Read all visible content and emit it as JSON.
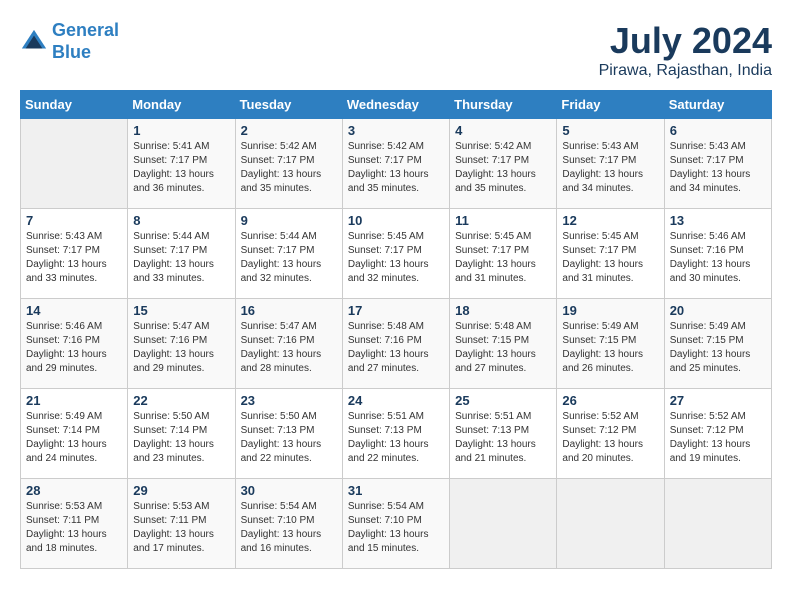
{
  "header": {
    "logo_line1": "General",
    "logo_line2": "Blue",
    "month_year": "July 2024",
    "location": "Pirawa, Rajasthan, India"
  },
  "weekdays": [
    "Sunday",
    "Monday",
    "Tuesday",
    "Wednesday",
    "Thursday",
    "Friday",
    "Saturday"
  ],
  "weeks": [
    [
      {
        "day": "",
        "sunrise": "",
        "sunset": "",
        "daylight": ""
      },
      {
        "day": "1",
        "sunrise": "Sunrise: 5:41 AM",
        "sunset": "Sunset: 7:17 PM",
        "daylight": "Daylight: 13 hours and 36 minutes."
      },
      {
        "day": "2",
        "sunrise": "Sunrise: 5:42 AM",
        "sunset": "Sunset: 7:17 PM",
        "daylight": "Daylight: 13 hours and 35 minutes."
      },
      {
        "day": "3",
        "sunrise": "Sunrise: 5:42 AM",
        "sunset": "Sunset: 7:17 PM",
        "daylight": "Daylight: 13 hours and 35 minutes."
      },
      {
        "day": "4",
        "sunrise": "Sunrise: 5:42 AM",
        "sunset": "Sunset: 7:17 PM",
        "daylight": "Daylight: 13 hours and 35 minutes."
      },
      {
        "day": "5",
        "sunrise": "Sunrise: 5:43 AM",
        "sunset": "Sunset: 7:17 PM",
        "daylight": "Daylight: 13 hours and 34 minutes."
      },
      {
        "day": "6",
        "sunrise": "Sunrise: 5:43 AM",
        "sunset": "Sunset: 7:17 PM",
        "daylight": "Daylight: 13 hours and 34 minutes."
      }
    ],
    [
      {
        "day": "7",
        "sunrise": "Sunrise: 5:43 AM",
        "sunset": "Sunset: 7:17 PM",
        "daylight": "Daylight: 13 hours and 33 minutes."
      },
      {
        "day": "8",
        "sunrise": "Sunrise: 5:44 AM",
        "sunset": "Sunset: 7:17 PM",
        "daylight": "Daylight: 13 hours and 33 minutes."
      },
      {
        "day": "9",
        "sunrise": "Sunrise: 5:44 AM",
        "sunset": "Sunset: 7:17 PM",
        "daylight": "Daylight: 13 hours and 32 minutes."
      },
      {
        "day": "10",
        "sunrise": "Sunrise: 5:45 AM",
        "sunset": "Sunset: 7:17 PM",
        "daylight": "Daylight: 13 hours and 32 minutes."
      },
      {
        "day": "11",
        "sunrise": "Sunrise: 5:45 AM",
        "sunset": "Sunset: 7:17 PM",
        "daylight": "Daylight: 13 hours and 31 minutes."
      },
      {
        "day": "12",
        "sunrise": "Sunrise: 5:45 AM",
        "sunset": "Sunset: 7:17 PM",
        "daylight": "Daylight: 13 hours and 31 minutes."
      },
      {
        "day": "13",
        "sunrise": "Sunrise: 5:46 AM",
        "sunset": "Sunset: 7:16 PM",
        "daylight": "Daylight: 13 hours and 30 minutes."
      }
    ],
    [
      {
        "day": "14",
        "sunrise": "Sunrise: 5:46 AM",
        "sunset": "Sunset: 7:16 PM",
        "daylight": "Daylight: 13 hours and 29 minutes."
      },
      {
        "day": "15",
        "sunrise": "Sunrise: 5:47 AM",
        "sunset": "Sunset: 7:16 PM",
        "daylight": "Daylight: 13 hours and 29 minutes."
      },
      {
        "day": "16",
        "sunrise": "Sunrise: 5:47 AM",
        "sunset": "Sunset: 7:16 PM",
        "daylight": "Daylight: 13 hours and 28 minutes."
      },
      {
        "day": "17",
        "sunrise": "Sunrise: 5:48 AM",
        "sunset": "Sunset: 7:16 PM",
        "daylight": "Daylight: 13 hours and 27 minutes."
      },
      {
        "day": "18",
        "sunrise": "Sunrise: 5:48 AM",
        "sunset": "Sunset: 7:15 PM",
        "daylight": "Daylight: 13 hours and 27 minutes."
      },
      {
        "day": "19",
        "sunrise": "Sunrise: 5:49 AM",
        "sunset": "Sunset: 7:15 PM",
        "daylight": "Daylight: 13 hours and 26 minutes."
      },
      {
        "day": "20",
        "sunrise": "Sunrise: 5:49 AM",
        "sunset": "Sunset: 7:15 PM",
        "daylight": "Daylight: 13 hours and 25 minutes."
      }
    ],
    [
      {
        "day": "21",
        "sunrise": "Sunrise: 5:49 AM",
        "sunset": "Sunset: 7:14 PM",
        "daylight": "Daylight: 13 hours and 24 minutes."
      },
      {
        "day": "22",
        "sunrise": "Sunrise: 5:50 AM",
        "sunset": "Sunset: 7:14 PM",
        "daylight": "Daylight: 13 hours and 23 minutes."
      },
      {
        "day": "23",
        "sunrise": "Sunrise: 5:50 AM",
        "sunset": "Sunset: 7:13 PM",
        "daylight": "Daylight: 13 hours and 22 minutes."
      },
      {
        "day": "24",
        "sunrise": "Sunrise: 5:51 AM",
        "sunset": "Sunset: 7:13 PM",
        "daylight": "Daylight: 13 hours and 22 minutes."
      },
      {
        "day": "25",
        "sunrise": "Sunrise: 5:51 AM",
        "sunset": "Sunset: 7:13 PM",
        "daylight": "Daylight: 13 hours and 21 minutes."
      },
      {
        "day": "26",
        "sunrise": "Sunrise: 5:52 AM",
        "sunset": "Sunset: 7:12 PM",
        "daylight": "Daylight: 13 hours and 20 minutes."
      },
      {
        "day": "27",
        "sunrise": "Sunrise: 5:52 AM",
        "sunset": "Sunset: 7:12 PM",
        "daylight": "Daylight: 13 hours and 19 minutes."
      }
    ],
    [
      {
        "day": "28",
        "sunrise": "Sunrise: 5:53 AM",
        "sunset": "Sunset: 7:11 PM",
        "daylight": "Daylight: 13 hours and 18 minutes."
      },
      {
        "day": "29",
        "sunrise": "Sunrise: 5:53 AM",
        "sunset": "Sunset: 7:11 PM",
        "daylight": "Daylight: 13 hours and 17 minutes."
      },
      {
        "day": "30",
        "sunrise": "Sunrise: 5:54 AM",
        "sunset": "Sunset: 7:10 PM",
        "daylight": "Daylight: 13 hours and 16 minutes."
      },
      {
        "day": "31",
        "sunrise": "Sunrise: 5:54 AM",
        "sunset": "Sunset: 7:10 PM",
        "daylight": "Daylight: 13 hours and 15 minutes."
      },
      {
        "day": "",
        "sunrise": "",
        "sunset": "",
        "daylight": ""
      },
      {
        "day": "",
        "sunrise": "",
        "sunset": "",
        "daylight": ""
      },
      {
        "day": "",
        "sunrise": "",
        "sunset": "",
        "daylight": ""
      }
    ]
  ]
}
